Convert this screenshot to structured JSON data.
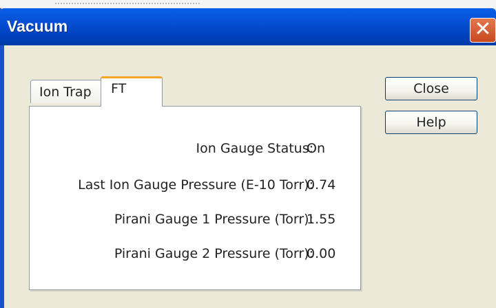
{
  "window": {
    "title": "Vacuum",
    "close_glyph": "✕"
  },
  "tabs": [
    {
      "label": "Ion Trap"
    },
    {
      "label": "FT"
    }
  ],
  "rows": [
    {
      "label": "Ion Gauge Status:",
      "value": "On"
    },
    {
      "label": "Last Ion Gauge Pressure (E-10 Torr):",
      "value": "0.74"
    },
    {
      "label": "Pirani Gauge 1 Pressure (Torr):",
      "value": "1.55"
    },
    {
      "label": "Pirani Gauge 2 Pressure (Torr):",
      "value": "0.00"
    }
  ],
  "buttons": {
    "close_label": "Close",
    "help_label": "Help"
  }
}
